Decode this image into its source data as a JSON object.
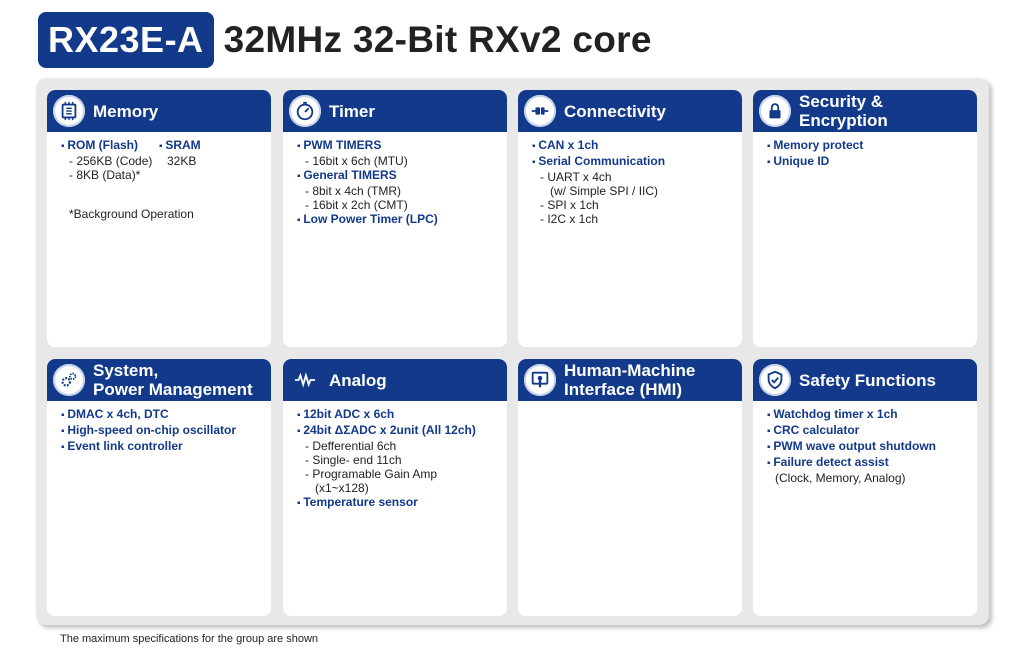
{
  "header": {
    "badge": "RX23E-A",
    "title": "32MHz 32-Bit RXv2 core"
  },
  "cards": {
    "memory": {
      "title": "Memory",
      "rom": "ROM (Flash)",
      "rom_code": "- 256KB (Code)",
      "rom_data": "- 8KB (Data)*",
      "sram": "SRAM",
      "sram_size": "32KB",
      "note": "*Background Operation"
    },
    "timer": {
      "title": "Timer",
      "pwm": "PWM TIMERS",
      "pwm_mtu": "- 16bit x 6ch (MTU)",
      "general": "General TIMERS",
      "tmr": "- 8bit x 4ch (TMR)",
      "cmt": "- 16bit x 2ch (CMT)",
      "lpc": "Low Power Timer (LPC)"
    },
    "connectivity": {
      "title": "Connectivity",
      "can": "CAN x 1ch",
      "serial": "Serial Communication",
      "uart": "- UART x 4ch",
      "uart_note": "(w/ Simple SPI / IIC)",
      "spi": "- SPI x 1ch",
      "i2c": "- I2C x 1ch"
    },
    "security": {
      "title_line1": "Security &",
      "title_line2": "Encryption",
      "memory_protect": "Memory protect",
      "unique_id": "Unique ID"
    },
    "system": {
      "title_line1": "System,",
      "title_line2": "Power Management",
      "dmac": "DMAC x 4ch, DTC",
      "osc": "High-speed on-chip oscillator",
      "elc": "Event link controller"
    },
    "analog": {
      "title": "Analog",
      "adc12": "12bit  ADC x 6ch",
      "adc24": "24bit ΔΣADC x 2unit (All 12ch)",
      "diff": "- Defferential 6ch",
      "single": "- Single- end 11ch",
      "pga": "- Programable Gain Amp",
      "pga_range": "(x1~x128)",
      "temp": "Temperature sensor"
    },
    "hmi": {
      "title_line1": "Human-Machine",
      "title_line2": "Interface (HMI)"
    },
    "safety": {
      "title": "Safety Functions",
      "wdt": "Watchdog timer x 1ch",
      "crc": "CRC calculator",
      "pwm_shutdown": "PWM wave output shutdown",
      "failure": "Failure detect assist",
      "failure_note": "(Clock, Memory, Analog)"
    }
  },
  "footer": "The maximum specifications for the group are shown",
  "colors": {
    "brand": "#12398a",
    "panel": "#e8e8e8"
  },
  "icons": [
    "memory-chip-icon",
    "stopwatch-icon",
    "plug-icon",
    "lock-icon",
    "gears-icon",
    "waveform-icon",
    "touch-screen-icon",
    "shield-check-icon"
  ]
}
